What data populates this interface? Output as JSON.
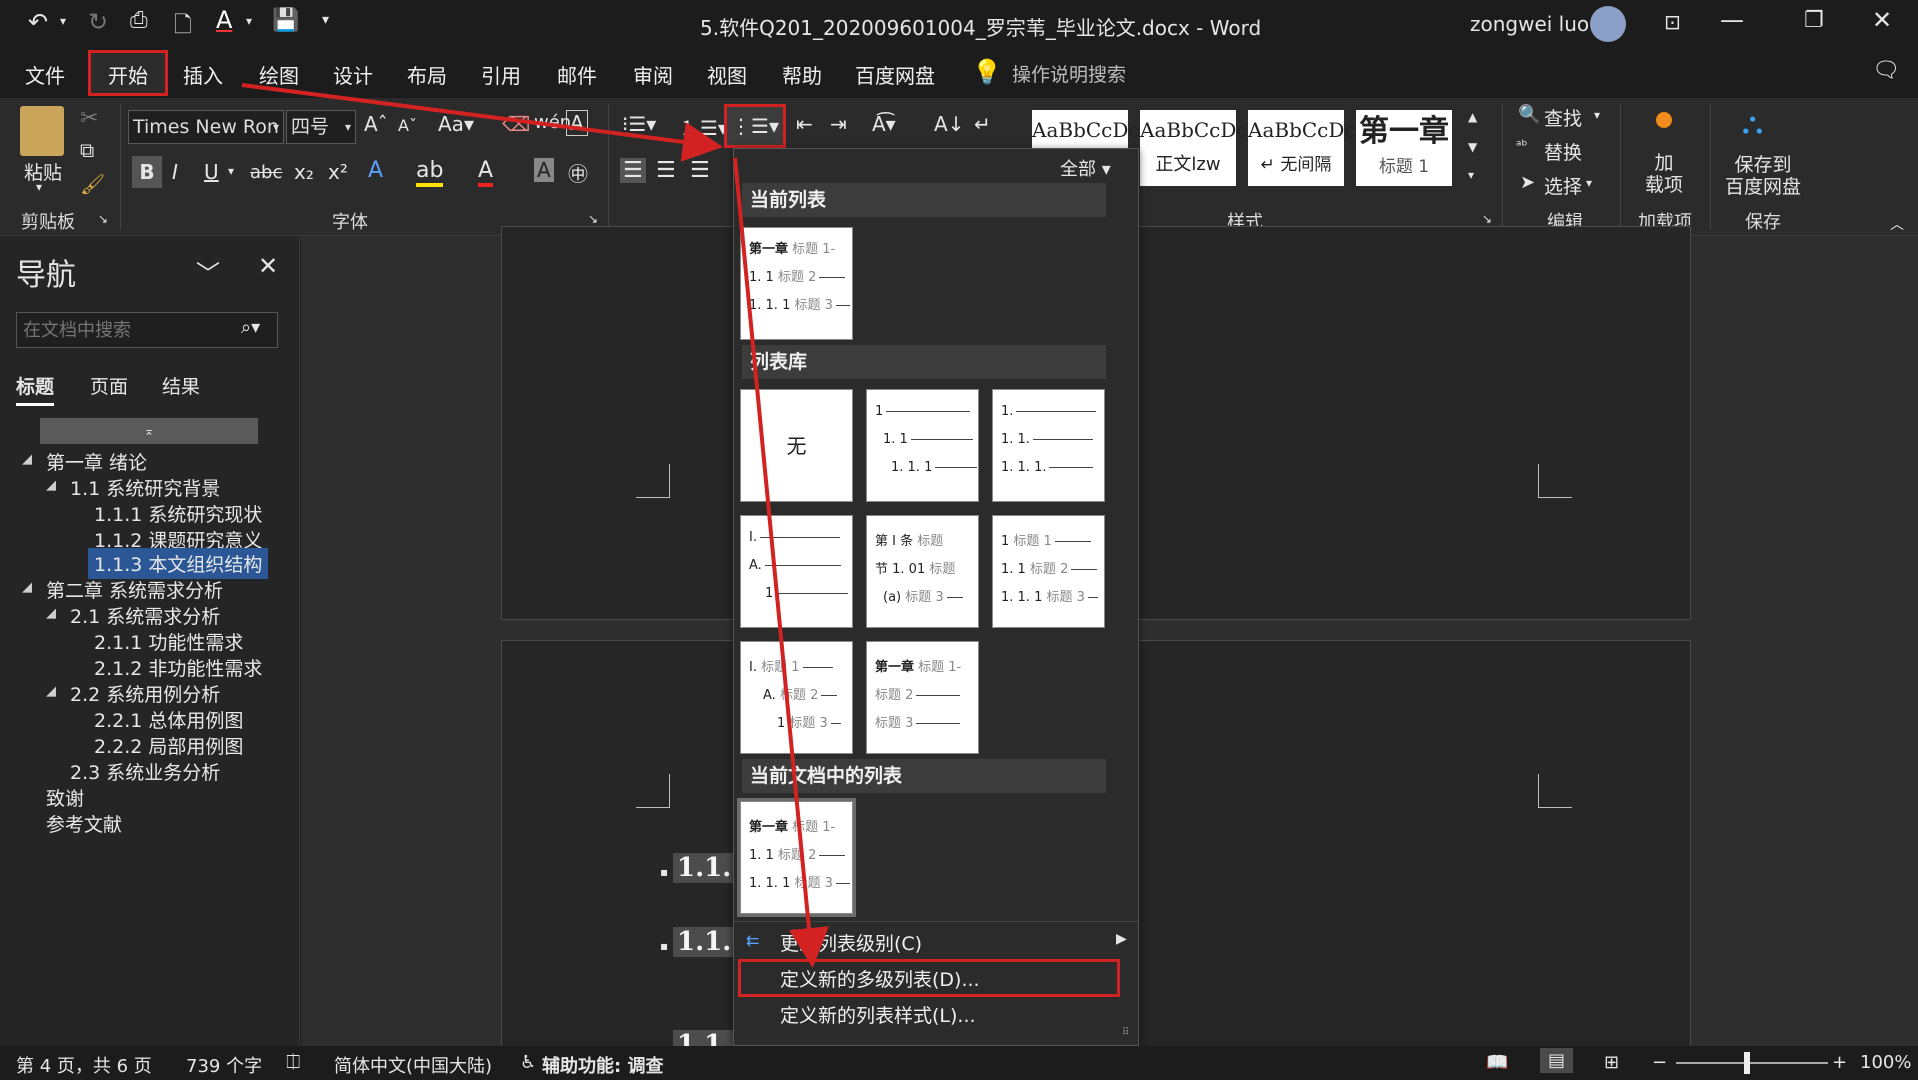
{
  "window": {
    "title": "5.软件Q201_202009601004_罗宗苇_毕业论文.docx  -  Word",
    "user": "zongwei luo"
  },
  "tabs": [
    "文件",
    "开始",
    "插入",
    "绘图",
    "设计",
    "布局",
    "引用",
    "邮件",
    "审阅",
    "视图",
    "帮助",
    "百度网盘"
  ],
  "tell_me": "操作说明搜索",
  "ribbon": {
    "clipboard": {
      "paste": "粘贴",
      "label": "剪贴板"
    },
    "font": {
      "name": "Times New Ron",
      "size": "四号",
      "label": "字体"
    },
    "styles": {
      "items": [
        {
          "preview": "AaBbCcDc",
          "name": ""
        },
        {
          "preview": "AaBbCcDc",
          "name": "正文lzw"
        },
        {
          "preview": "AaBbCcDc",
          "name": "↵ 无间隔"
        },
        {
          "preview": "第一章",
          "name": "标题 1"
        }
      ],
      "label": "样式"
    },
    "editing": {
      "find": "查找",
      "replace": "替换",
      "select": "选择",
      "label": "编辑"
    },
    "addins": {
      "btn_line1": "加",
      "btn_line2": "载项",
      "label": "加载项"
    },
    "save": {
      "line1": "保存到",
      "line2": "百度网盘",
      "label": "保存"
    }
  },
  "nav": {
    "title": "导航",
    "search_placeholder": "在文档中搜索",
    "tabs": [
      "标题",
      "页面",
      "结果"
    ],
    "items": [
      {
        "text": "第一章 绪论"
      },
      {
        "text": "1.1 系统研究背景"
      },
      {
        "text": "1.1.1 系统研究现状"
      },
      {
        "text": "1.1.2 课题研究意义"
      },
      {
        "text": "1.1.3 本文组织结构"
      },
      {
        "text": "第二章 系统需求分析"
      },
      {
        "text": "2.1 系统需求分析"
      },
      {
        "text": "2.1.1 功能性需求"
      },
      {
        "text": "2.1.2 非功能性需求"
      },
      {
        "text": "2.2 系统用例分析"
      },
      {
        "text": "2.2.1 总体用例图"
      },
      {
        "text": "2.2.2 局部用例图"
      },
      {
        "text": "2.3 系统业务分析"
      },
      {
        "text": "致谢"
      },
      {
        "text": "参考文献"
      }
    ]
  },
  "doc": {
    "headings": [
      "1.1.1",
      "1.1.2",
      "1.1.3"
    ]
  },
  "menu": {
    "filter": "全部",
    "sec_current": "当前列表",
    "sec_library": "列表库",
    "sec_doc": "当前文档中的列表",
    "none": "无",
    "change_level": "更改列表级别(C)",
    "define_multi": "定义新的多级列表(D)...",
    "define_style": "定义新的列表样式(L)..."
  },
  "status": {
    "page": "第 4 页，共 6 页",
    "words": "739 个字",
    "lang": "简体中文(中国大陆)",
    "access": "辅助功能: 调查",
    "zoom": "100%"
  },
  "colors": {
    "accent_red": "#d32222",
    "selected_nav": "#2b5797"
  }
}
